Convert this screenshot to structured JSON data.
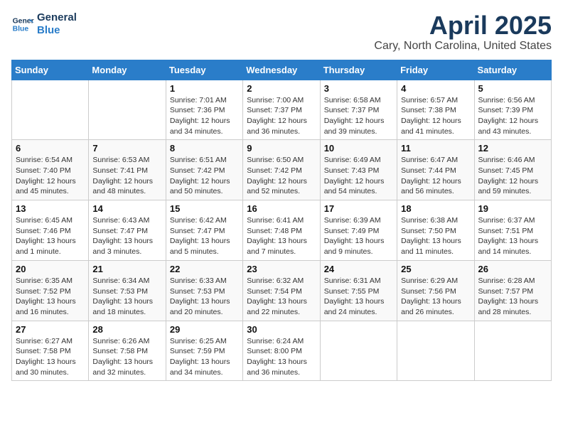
{
  "logo": {
    "line1": "General",
    "line2": "Blue"
  },
  "title": "April 2025",
  "subtitle": "Cary, North Carolina, United States",
  "weekdays": [
    "Sunday",
    "Monday",
    "Tuesday",
    "Wednesday",
    "Thursday",
    "Friday",
    "Saturday"
  ],
  "weeks": [
    [
      {
        "day": "",
        "detail": ""
      },
      {
        "day": "",
        "detail": ""
      },
      {
        "day": "1",
        "detail": "Sunrise: 7:01 AM\nSunset: 7:36 PM\nDaylight: 12 hours and 34 minutes."
      },
      {
        "day": "2",
        "detail": "Sunrise: 7:00 AM\nSunset: 7:37 PM\nDaylight: 12 hours and 36 minutes."
      },
      {
        "day": "3",
        "detail": "Sunrise: 6:58 AM\nSunset: 7:37 PM\nDaylight: 12 hours and 39 minutes."
      },
      {
        "day": "4",
        "detail": "Sunrise: 6:57 AM\nSunset: 7:38 PM\nDaylight: 12 hours and 41 minutes."
      },
      {
        "day": "5",
        "detail": "Sunrise: 6:56 AM\nSunset: 7:39 PM\nDaylight: 12 hours and 43 minutes."
      }
    ],
    [
      {
        "day": "6",
        "detail": "Sunrise: 6:54 AM\nSunset: 7:40 PM\nDaylight: 12 hours and 45 minutes."
      },
      {
        "day": "7",
        "detail": "Sunrise: 6:53 AM\nSunset: 7:41 PM\nDaylight: 12 hours and 48 minutes."
      },
      {
        "day": "8",
        "detail": "Sunrise: 6:51 AM\nSunset: 7:42 PM\nDaylight: 12 hours and 50 minutes."
      },
      {
        "day": "9",
        "detail": "Sunrise: 6:50 AM\nSunset: 7:42 PM\nDaylight: 12 hours and 52 minutes."
      },
      {
        "day": "10",
        "detail": "Sunrise: 6:49 AM\nSunset: 7:43 PM\nDaylight: 12 hours and 54 minutes."
      },
      {
        "day": "11",
        "detail": "Sunrise: 6:47 AM\nSunset: 7:44 PM\nDaylight: 12 hours and 56 minutes."
      },
      {
        "day": "12",
        "detail": "Sunrise: 6:46 AM\nSunset: 7:45 PM\nDaylight: 12 hours and 59 minutes."
      }
    ],
    [
      {
        "day": "13",
        "detail": "Sunrise: 6:45 AM\nSunset: 7:46 PM\nDaylight: 13 hours and 1 minute."
      },
      {
        "day": "14",
        "detail": "Sunrise: 6:43 AM\nSunset: 7:47 PM\nDaylight: 13 hours and 3 minutes."
      },
      {
        "day": "15",
        "detail": "Sunrise: 6:42 AM\nSunset: 7:47 PM\nDaylight: 13 hours and 5 minutes."
      },
      {
        "day": "16",
        "detail": "Sunrise: 6:41 AM\nSunset: 7:48 PM\nDaylight: 13 hours and 7 minutes."
      },
      {
        "day": "17",
        "detail": "Sunrise: 6:39 AM\nSunset: 7:49 PM\nDaylight: 13 hours and 9 minutes."
      },
      {
        "day": "18",
        "detail": "Sunrise: 6:38 AM\nSunset: 7:50 PM\nDaylight: 13 hours and 11 minutes."
      },
      {
        "day": "19",
        "detail": "Sunrise: 6:37 AM\nSunset: 7:51 PM\nDaylight: 13 hours and 14 minutes."
      }
    ],
    [
      {
        "day": "20",
        "detail": "Sunrise: 6:35 AM\nSunset: 7:52 PM\nDaylight: 13 hours and 16 minutes."
      },
      {
        "day": "21",
        "detail": "Sunrise: 6:34 AM\nSunset: 7:53 PM\nDaylight: 13 hours and 18 minutes."
      },
      {
        "day": "22",
        "detail": "Sunrise: 6:33 AM\nSunset: 7:53 PM\nDaylight: 13 hours and 20 minutes."
      },
      {
        "day": "23",
        "detail": "Sunrise: 6:32 AM\nSunset: 7:54 PM\nDaylight: 13 hours and 22 minutes."
      },
      {
        "day": "24",
        "detail": "Sunrise: 6:31 AM\nSunset: 7:55 PM\nDaylight: 13 hours and 24 minutes."
      },
      {
        "day": "25",
        "detail": "Sunrise: 6:29 AM\nSunset: 7:56 PM\nDaylight: 13 hours and 26 minutes."
      },
      {
        "day": "26",
        "detail": "Sunrise: 6:28 AM\nSunset: 7:57 PM\nDaylight: 13 hours and 28 minutes."
      }
    ],
    [
      {
        "day": "27",
        "detail": "Sunrise: 6:27 AM\nSunset: 7:58 PM\nDaylight: 13 hours and 30 minutes."
      },
      {
        "day": "28",
        "detail": "Sunrise: 6:26 AM\nSunset: 7:58 PM\nDaylight: 13 hours and 32 minutes."
      },
      {
        "day": "29",
        "detail": "Sunrise: 6:25 AM\nSunset: 7:59 PM\nDaylight: 13 hours and 34 minutes."
      },
      {
        "day": "30",
        "detail": "Sunrise: 6:24 AM\nSunset: 8:00 PM\nDaylight: 13 hours and 36 minutes."
      },
      {
        "day": "",
        "detail": ""
      },
      {
        "day": "",
        "detail": ""
      },
      {
        "day": "",
        "detail": ""
      }
    ]
  ]
}
